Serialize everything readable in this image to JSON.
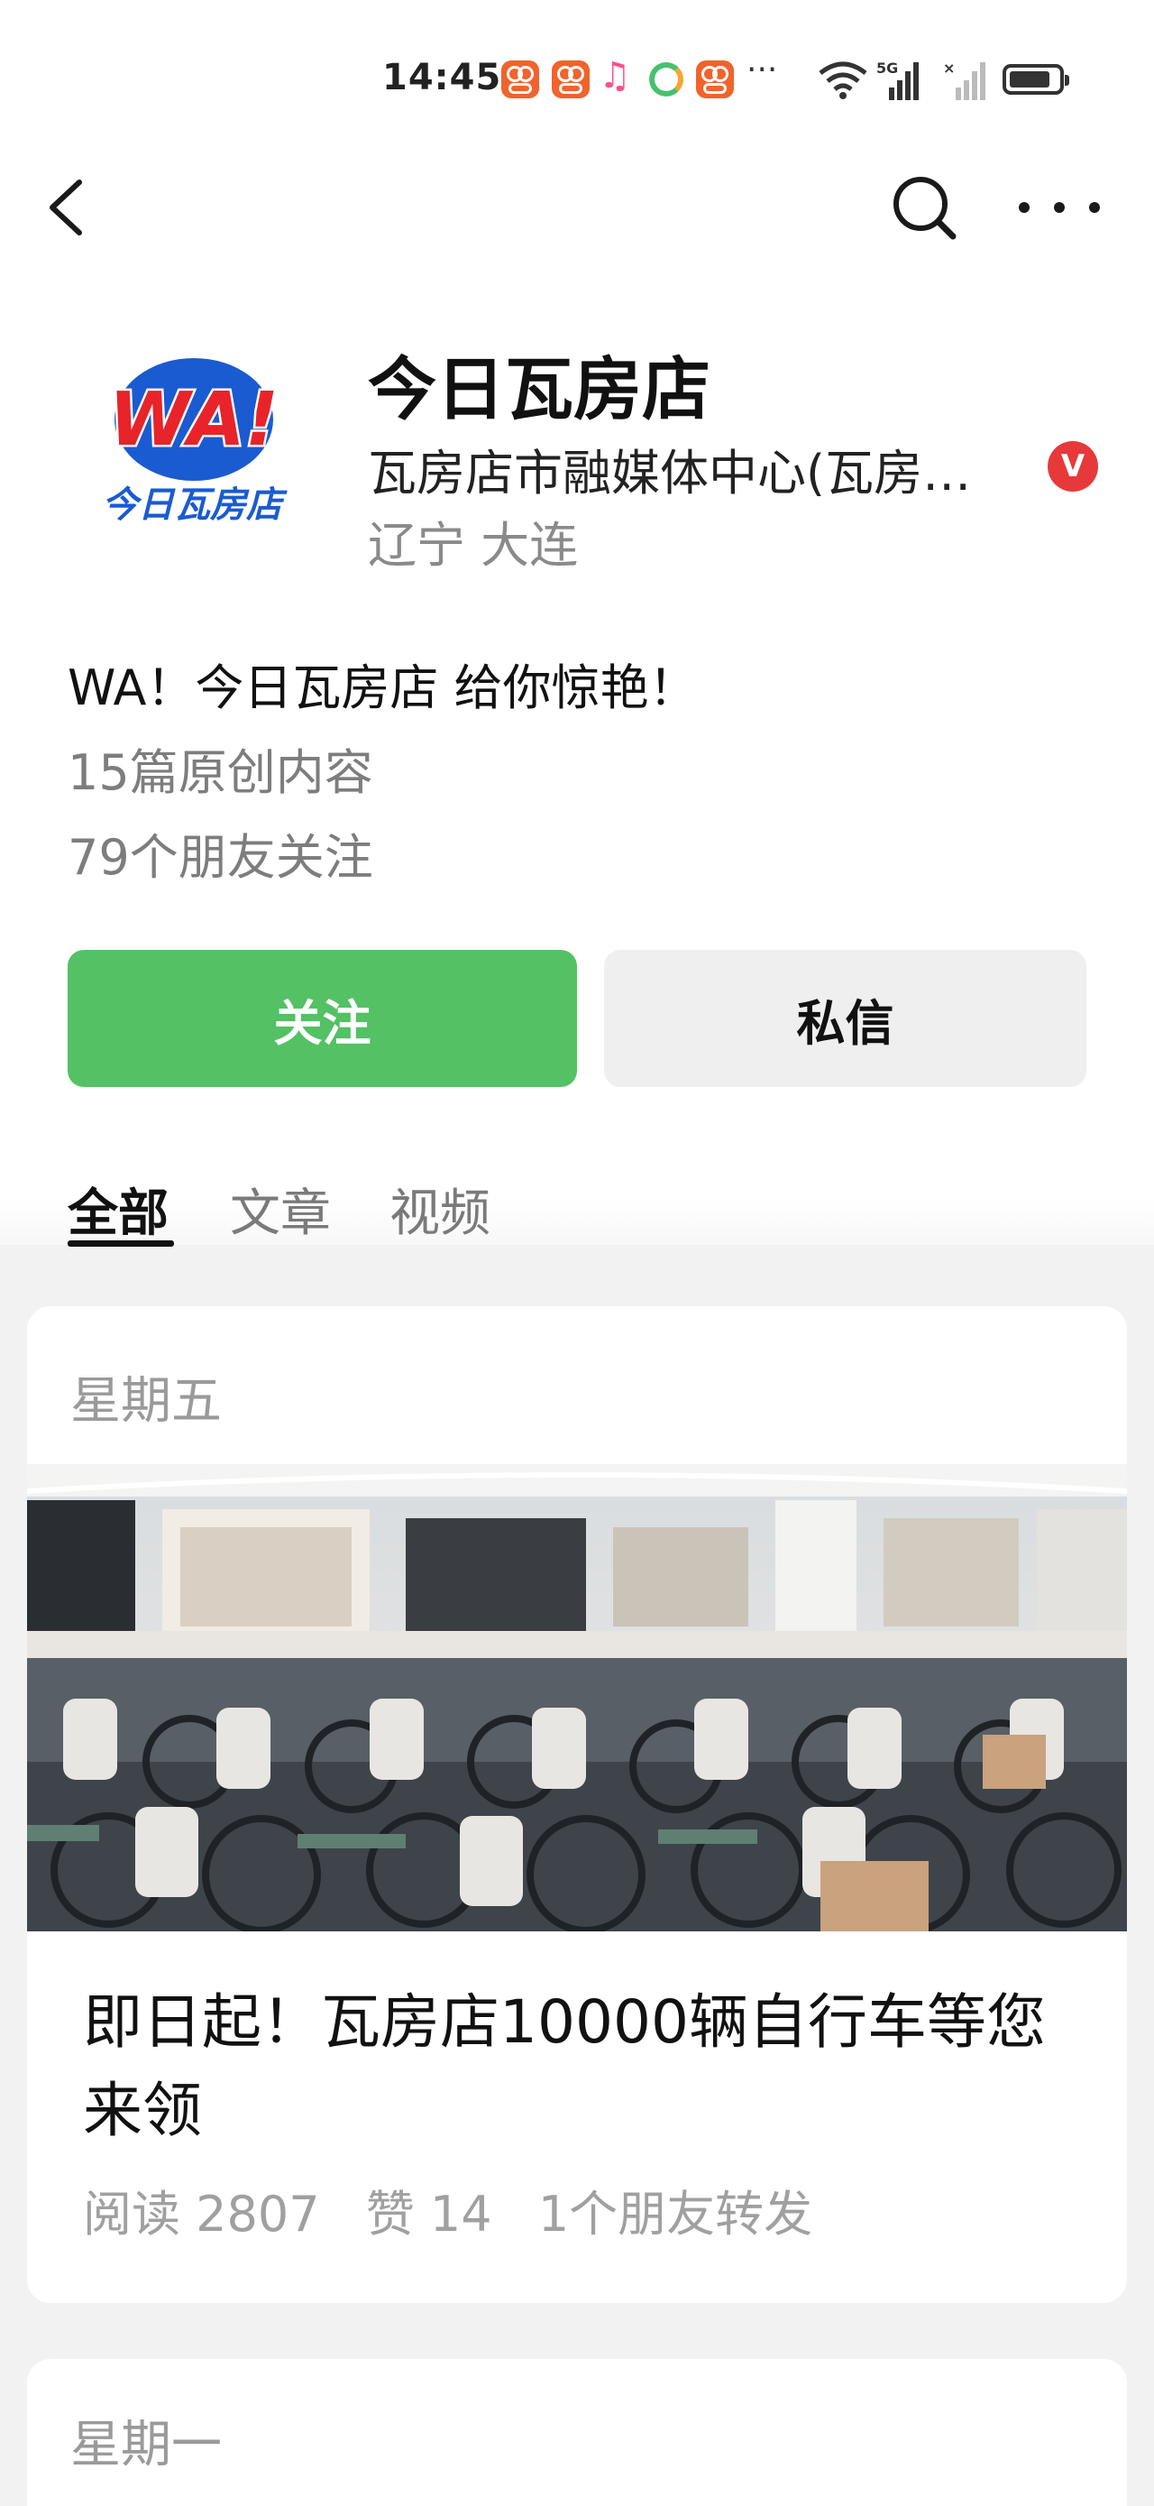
{
  "status_bar": {
    "time": "14:45",
    "icons": [
      "app-badge-icon",
      "app-badge-icon",
      "music-icon",
      "sync-icon",
      "app-badge-icon",
      "more-dots-icon",
      "wifi-icon",
      "signal-5g-icon",
      "signal-icon",
      "battery-icon"
    ],
    "battery_level": 0.85
  },
  "nav": {
    "back_icon": "chevron-left-icon",
    "search_icon": "search-icon",
    "more_icon": "more-icon"
  },
  "profile": {
    "avatar_logo_text": "WA!",
    "avatar_logo_caption": "今日瓦房店",
    "name": "今日瓦房店",
    "owner": "瓦房店市融媒体中心(瓦房店市广播电视台)",
    "verified_badge": "V",
    "region": "辽宁 大连",
    "bio": "WA！今日瓦房店 给你惊艳！",
    "original_count": "15篇原创内容",
    "friends_following": "79个朋友关注"
  },
  "actions": {
    "follow_label": "关注",
    "message_label": "私信"
  },
  "tabs": [
    {
      "label": "全部",
      "active": true
    },
    {
      "label": "文章",
      "active": false
    },
    {
      "label": "视频",
      "active": false
    }
  ],
  "articles": [
    {
      "day": "星期五",
      "title": "即日起！瓦房店10000辆自行车等您来领",
      "reads": "阅读 2807",
      "likes": "赞 14",
      "shares": "1个朋友转发"
    },
    {
      "day": "星期一"
    }
  ],
  "colors": {
    "accent_green": "#53c164",
    "verified_red": "#e7393a",
    "logo_blue": "#1a5bd1",
    "logo_red": "#e8232a"
  }
}
